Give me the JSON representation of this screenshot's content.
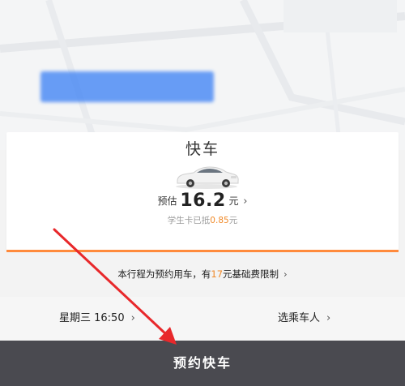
{
  "vehicle": {
    "name": "快车",
    "price_prefix": "预估",
    "price_value": "16.2",
    "price_unit": "元",
    "discount_prefix": "学生卡已抵",
    "discount_amount": "0.85",
    "discount_unit": "元"
  },
  "notice": {
    "text_before": "本行程为预约用车，有",
    "amount": "17",
    "text_after": "元基础费限制"
  },
  "options": {
    "time_label": "星期三 16:50",
    "passenger_label": "选乘车人"
  },
  "book_button": {
    "label": "预约快车"
  },
  "icons": {
    "chevron": "chevron-right-icon",
    "car": "car-icon",
    "annotation": "red-arrow-icon"
  },
  "colors": {
    "accent_orange": "#f08a2a",
    "card_underline": "#ff8a3c",
    "map_button_blue": "#4f8df5",
    "book_button_bg": "#4a4a50",
    "annotation_red": "#e8282b"
  }
}
